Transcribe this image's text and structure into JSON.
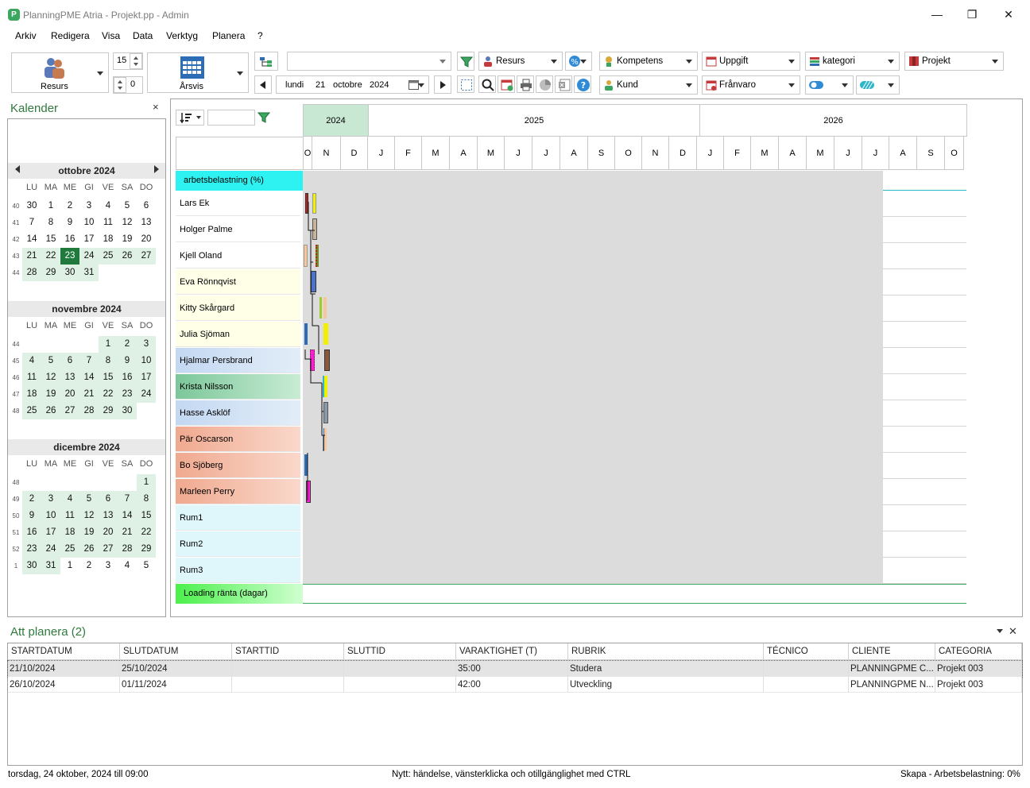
{
  "window": {
    "title": "PlanningPME Atria - Projekt.pp - Admin",
    "app_icon": "P",
    "minimize": "—",
    "maximize": "❐",
    "close": "✕"
  },
  "menu": [
    "Arkiv",
    "Redigera",
    "Visa",
    "Data",
    "Verktyg",
    "Planera",
    "?"
  ],
  "toolbar": {
    "resource_button": "Resurs",
    "view_button": "Årsvis",
    "spin_top": "15",
    "spin_bottom": "0",
    "date": {
      "weekday": "lundi",
      "day": "21",
      "month": "octobre",
      "year": "2024"
    },
    "combos": {
      "resurs": "Resurs",
      "kompetens": "Kompetens",
      "uppgift": "Uppgift",
      "kategori": "kategori",
      "projekt": "Projekt",
      "kund": "Kund",
      "franvaro": "Frånvaro"
    },
    "search_value": ""
  },
  "sidebar": {
    "title": "Kalender",
    "close": "×",
    "weekdays": [
      "LU",
      "MA",
      "ME",
      "GI",
      "VE",
      "SA",
      "DO"
    ],
    "months": [
      {
        "name": "ottobre 2024",
        "weeks": [
          {
            "wk": "40",
            "days": [
              [
                "30",
                1
              ],
              [
                "1",
                0
              ],
              [
                "2",
                0
              ],
              [
                "3",
                0
              ],
              [
                "4",
                0
              ],
              [
                "5",
                0
              ],
              [
                "6",
                0
              ]
            ]
          },
          {
            "wk": "41",
            "days": [
              [
                "7",
                0
              ],
              [
                "8",
                0
              ],
              [
                "9",
                0
              ],
              [
                "10",
                0
              ],
              [
                "11",
                0
              ],
              [
                "12",
                0
              ],
              [
                "13",
                0
              ]
            ]
          },
          {
            "wk": "42",
            "days": [
              [
                "14",
                0
              ],
              [
                "15",
                0
              ],
              [
                "16",
                0
              ],
              [
                "17",
                0
              ],
              [
                "18",
                0
              ],
              [
                "19",
                0
              ],
              [
                "20",
                0
              ]
            ]
          },
          {
            "wk": "43",
            "days": [
              [
                "21",
                2
              ],
              [
                "22",
                2
              ],
              [
                "23",
                3
              ],
              [
                "24",
                2
              ],
              [
                "25",
                2
              ],
              [
                "26",
                2
              ],
              [
                "27",
                2
              ]
            ]
          },
          {
            "wk": "44",
            "days": [
              [
                "28",
                2
              ],
              [
                "29",
                2
              ],
              [
                "30",
                2
              ],
              [
                "31",
                2
              ]
            ]
          }
        ]
      },
      {
        "name": "novembre 2024",
        "weeks": [
          {
            "wk": "44",
            "days": [
              [
                "",
                1
              ],
              [
                "",
                1
              ],
              [
                "",
                1
              ],
              [
                "",
                1
              ],
              [
                "1",
                2
              ],
              [
                "2",
                2
              ],
              [
                "3",
                2
              ]
            ]
          },
          {
            "wk": "45",
            "days": [
              [
                "4",
                2
              ],
              [
                "5",
                2
              ],
              [
                "6",
                2
              ],
              [
                "7",
                2
              ],
              [
                "8",
                2
              ],
              [
                "9",
                2
              ],
              [
                "10",
                2
              ]
            ]
          },
          {
            "wk": "46",
            "days": [
              [
                "11",
                2
              ],
              [
                "12",
                2
              ],
              [
                "13",
                2
              ],
              [
                "14",
                2
              ],
              [
                "15",
                2
              ],
              [
                "16",
                2
              ],
              [
                "17",
                2
              ]
            ]
          },
          {
            "wk": "47",
            "days": [
              [
                "18",
                2
              ],
              [
                "19",
                2
              ],
              [
                "20",
                2
              ],
              [
                "21",
                2
              ],
              [
                "22",
                2
              ],
              [
                "23",
                2
              ],
              [
                "24",
                2
              ]
            ]
          },
          {
            "wk": "48",
            "days": [
              [
                "25",
                2
              ],
              [
                "26",
                2
              ],
              [
                "27",
                2
              ],
              [
                "28",
                2
              ],
              [
                "29",
                2
              ],
              [
                "30",
                2
              ]
            ]
          }
        ]
      },
      {
        "name": "dicembre 2024",
        "weeks": [
          {
            "wk": "48",
            "days": [
              [
                "",
                1
              ],
              [
                "",
                1
              ],
              [
                "",
                1
              ],
              [
                "",
                1
              ],
              [
                "",
                1
              ],
              [
                "",
                1
              ],
              [
                "1",
                2
              ]
            ]
          },
          {
            "wk": "49",
            "days": [
              [
                "2",
                2
              ],
              [
                "3",
                2
              ],
              [
                "4",
                2
              ],
              [
                "5",
                2
              ],
              [
                "6",
                2
              ],
              [
                "7",
                2
              ],
              [
                "8",
                2
              ]
            ]
          },
          {
            "wk": "50",
            "days": [
              [
                "9",
                2
              ],
              [
                "10",
                2
              ],
              [
                "11",
                2
              ],
              [
                "12",
                2
              ],
              [
                "13",
                2
              ],
              [
                "14",
                2
              ],
              [
                "15",
                2
              ]
            ]
          },
          {
            "wk": "51",
            "days": [
              [
                "16",
                2
              ],
              [
                "17",
                2
              ],
              [
                "18",
                2
              ],
              [
                "19",
                2
              ],
              [
                "20",
                2
              ],
              [
                "21",
                2
              ],
              [
                "22",
                2
              ]
            ]
          },
          {
            "wk": "52",
            "days": [
              [
                "23",
                2
              ],
              [
                "24",
                2
              ],
              [
                "25",
                2
              ],
              [
                "26",
                2
              ],
              [
                "27",
                2
              ],
              [
                "28",
                2
              ],
              [
                "29",
                2
              ]
            ]
          },
          {
            "wk": "1",
            "days": [
              [
                "30",
                2
              ],
              [
                "31",
                2
              ],
              [
                "1",
                1
              ],
              [
                "2",
                1
              ],
              [
                "3",
                1
              ],
              [
                "4",
                1
              ],
              [
                "5",
                1
              ]
            ]
          }
        ]
      }
    ]
  },
  "gantt": {
    "years": [
      "2024",
      "2025",
      "2026"
    ],
    "months": [
      "O",
      "N",
      "D",
      "J",
      "F",
      "M",
      "A",
      "M",
      "J",
      "J",
      "A",
      "S",
      "O",
      "N",
      "D",
      "J",
      "F",
      "M",
      "A",
      "M",
      "J",
      "J",
      "A",
      "S",
      "O"
    ],
    "load_row_label": "arbetsbelastning (%)",
    "footer_row_label": "Loading ränta (dagar)",
    "resources": [
      {
        "name": "Lars Ek",
        "color": "#ffffff"
      },
      {
        "name": "Holger Palme",
        "color": "#ffffff"
      },
      {
        "name": "Kjell Oland",
        "color": "#ffffff"
      },
      {
        "name": "Eva Rönnqvist",
        "color": "#ffffe8"
      },
      {
        "name": "Kitty Skårgard",
        "color": "#ffffe8"
      },
      {
        "name": "Julia Sjöman",
        "color": "#ffffe8"
      },
      {
        "name": "Hjalmar Persbrand",
        "color": "#cfe0f4"
      },
      {
        "name": "Krista Nilsson",
        "color": "#8ecfa8"
      },
      {
        "name": "Hasse Asklöf",
        "color": "#cfe0f4"
      },
      {
        "name": "Pär Oscarson",
        "color": "#f2b29c"
      },
      {
        "name": "Bo Sjöberg",
        "color": "#f2b29c"
      },
      {
        "name": "Marleen Perry",
        "color": "#f2b29c"
      },
      {
        "name": "Rum1",
        "color": "#dff7fb"
      },
      {
        "name": "Rum2",
        "color": "#dff7fb"
      },
      {
        "name": "Rum3",
        "color": "#dff7fb"
      }
    ]
  },
  "att_planera": {
    "title": "Att planera (2)",
    "columns": [
      "STARTDATUM",
      "SLUTDATUM",
      "STARTTID",
      "SLUTTID",
      "VARAKTIGHET (T)",
      "RUBRIK",
      "TÉCNICO",
      "CLIENTE",
      "CATEGORIA"
    ],
    "rows": [
      [
        "21/10/2024",
        "25/10/2024",
        "",
        "",
        "35:00",
        "Studera",
        "",
        "PLANNINGPME C...",
        "Projekt 003"
      ],
      [
        "26/10/2024",
        "01/11/2024",
        "",
        "",
        "42:00",
        "Utveckling",
        "",
        "PLANNINGPME N...",
        "Projekt 003"
      ]
    ]
  },
  "status": {
    "left": "torsdag, 24 oktober, 2024 till 09:00",
    "center": "Nytt: händelse, vänsterklicka och otillgänglighet med CTRL",
    "right": "Skapa - Arbetsbelastning: 0%"
  }
}
